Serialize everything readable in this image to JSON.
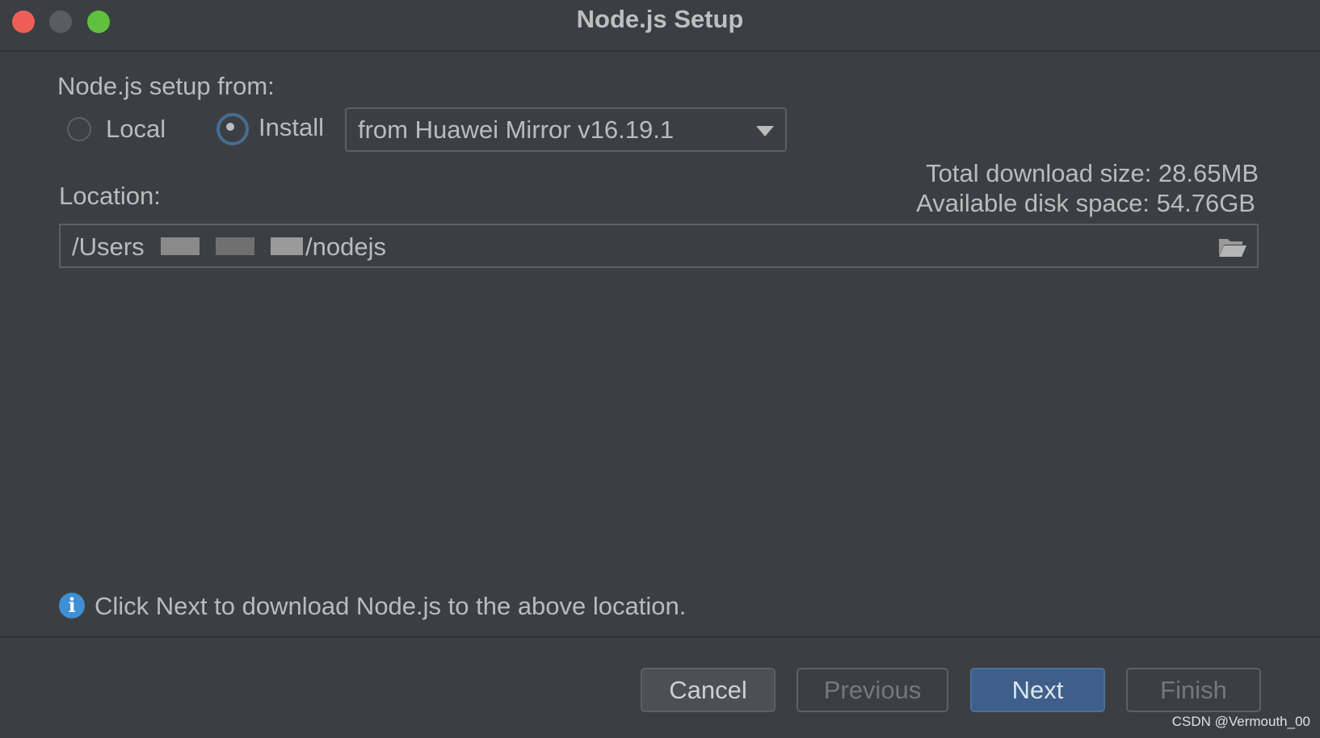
{
  "window": {
    "title": "Node.js Setup"
  },
  "setup": {
    "label": "Node.js setup from:",
    "options": [
      {
        "label": "Local",
        "selected": false
      },
      {
        "label": "Install",
        "selected": true
      }
    ],
    "source_select": {
      "value": "from Huawei Mirror v16.19.1"
    },
    "download_size": "Total download size: 28.65MB",
    "disk_space": "Available disk space: 54.76GB"
  },
  "location": {
    "label": "Location:",
    "value_prefix": "/Users",
    "value_suffix": "/nodejs",
    "browse_icon": "folder-open-icon"
  },
  "info": {
    "icon": "info-icon",
    "text": "Click Next to download Node.js to the above location."
  },
  "buttons": {
    "cancel": "Cancel",
    "previous": "Previous",
    "next": "Next",
    "finish": "Finish"
  },
  "colors": {
    "accent": "#3d5f8a",
    "info": "#3e8fd6",
    "close": "#ec5f57",
    "zoom": "#5fc13f"
  },
  "watermark": "CSDN @Vermouth_00"
}
